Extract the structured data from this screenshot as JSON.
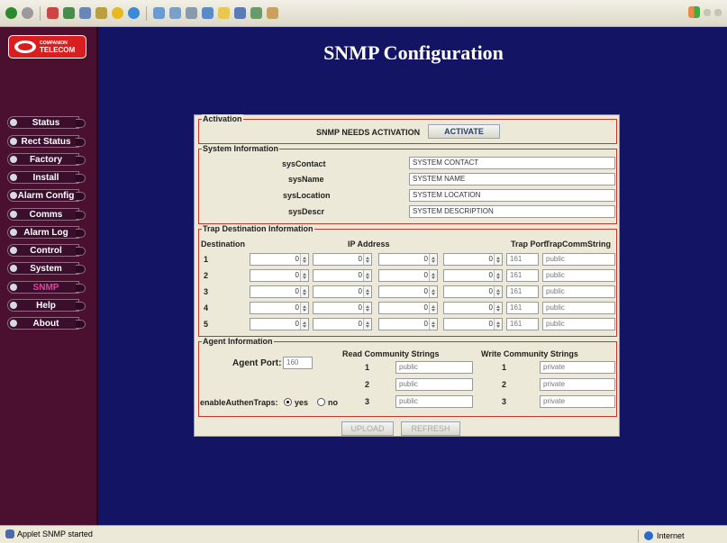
{
  "page": {
    "title": "SNMP Configuration"
  },
  "logo": {
    "line1": "COMPANION",
    "line2": "TELECOM"
  },
  "sidebar": {
    "items": [
      {
        "label": "Status"
      },
      {
        "label": "Rect Status"
      },
      {
        "label": "Factory"
      },
      {
        "label": "Install"
      },
      {
        "label": "Alarm Config"
      },
      {
        "label": "Comms"
      },
      {
        "label": "Alarm Log"
      },
      {
        "label": "Control"
      },
      {
        "label": "System"
      },
      {
        "label": "SNMP",
        "active": true
      },
      {
        "label": "Help"
      },
      {
        "label": "About"
      }
    ]
  },
  "activation": {
    "title": "Activation",
    "status_text": "SNMP NEEDS ACTIVATION",
    "button_label": "ACTIVATE"
  },
  "system_info": {
    "title": "System Information",
    "rows": [
      {
        "label": "sysContact",
        "value": "SYSTEM CONTACT"
      },
      {
        "label": "sysName",
        "value": "SYSTEM NAME"
      },
      {
        "label": "sysLocation",
        "value": "SYSTEM LOCATION"
      },
      {
        "label": "sysDescr",
        "value": "SYSTEM DESCRIPTION"
      }
    ]
  },
  "trap": {
    "title": "Trap Destination Information",
    "headers": {
      "destination": "Destination",
      "ip": "IP Address",
      "port": "Trap Port",
      "comm": "TrapCommString"
    },
    "rows": [
      {
        "dest": "1",
        "ip": [
          "0",
          "0",
          "0",
          "0"
        ],
        "port": "161",
        "comm": "public"
      },
      {
        "dest": "2",
        "ip": [
          "0",
          "0",
          "0",
          "0"
        ],
        "port": "161",
        "comm": "public"
      },
      {
        "dest": "3",
        "ip": [
          "0",
          "0",
          "0",
          "0"
        ],
        "port": "161",
        "comm": "public"
      },
      {
        "dest": "4",
        "ip": [
          "0",
          "0",
          "0",
          "0"
        ],
        "port": "161",
        "comm": "public"
      },
      {
        "dest": "5",
        "ip": [
          "0",
          "0",
          "0",
          "0"
        ],
        "port": "161",
        "comm": "public"
      }
    ]
  },
  "agent": {
    "title": "Agent Information",
    "port_label": "Agent Port:",
    "port_value": "160",
    "read_header": "Read Community Strings",
    "write_header": "Write Community Strings",
    "read": [
      {
        "n": "1",
        "value": "public"
      },
      {
        "n": "2",
        "value": "public"
      },
      {
        "n": "3",
        "value": "public"
      }
    ],
    "write": [
      {
        "n": "1",
        "value": "private"
      },
      {
        "n": "2",
        "value": "private"
      },
      {
        "n": "3",
        "value": "private"
      }
    ],
    "authen_label": "enableAuthenTraps:",
    "yes_label": "yes",
    "no_label": "no",
    "authen_selected": "yes"
  },
  "buttons": {
    "upload": "UPLOAD",
    "refresh": "REFRESH"
  },
  "statusbar": {
    "left_text": "Applet SNMP started",
    "right_text": "Internet"
  }
}
